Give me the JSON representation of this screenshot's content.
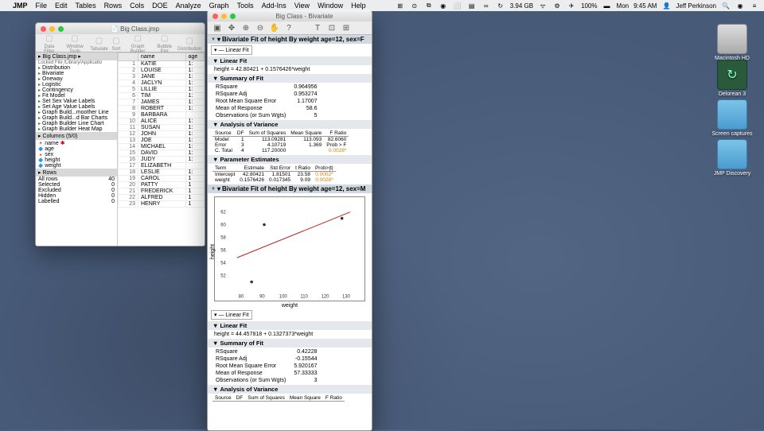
{
  "menubar": {
    "apple": "",
    "app": "JMP",
    "items": [
      "File",
      "Edit",
      "Tables",
      "Rows",
      "Cols",
      "DOE",
      "Analyze",
      "Graph",
      "Tools",
      "Add-Ins",
      "View",
      "Window",
      "Help"
    ],
    "right": {
      "icons": [
        "⊞",
        "⊙",
        "⧉",
        "◉",
        "⬜",
        "▤",
        "∞",
        "↻",
        "⚙",
        "✈",
        "ᛒ",
        "⏻",
        "⌨",
        "≡"
      ],
      "mem": "3.94 GB",
      "wifi": "ᯤ",
      "bat": "100%",
      "batico": "▬",
      "day": "Mon",
      "time": "9:45 AM",
      "user": "Jeff Perkinson",
      "spotlight": "🔍",
      "siri": "◉",
      "notif": "≡"
    }
  },
  "win1": {
    "title": "Big Class.jmp",
    "toolbar_labels": [
      "Data Filter",
      "Window Tools",
      "Tabulate",
      "Sort",
      "Graph Builder",
      "Bubble Plot",
      "Distribution"
    ],
    "panel_header": "Big Class.jmp",
    "locked": "Locked File  /Library/Applicatio",
    "scripts": [
      "Distribution",
      "Bivariate",
      "Oneway",
      "Logistic",
      "Contingency",
      "Fit Model",
      "Set Sex Value Labels",
      "Set Age Value Labels",
      "Graph Build...moother Line",
      "Graph Build...d Bar Charts",
      "Graph Builder Line Chart",
      "Graph Builder Heat Map"
    ],
    "cols_header": "Columns (5/0)",
    "cols": [
      "name",
      "age",
      "sex",
      "height",
      "weight"
    ],
    "rows_header": "Rows",
    "rows_stats": [
      [
        "All rows",
        "40"
      ],
      [
        "Selected",
        "0"
      ],
      [
        "Excluded",
        "0"
      ],
      [
        "Hidden",
        "0"
      ],
      [
        "Labelled",
        "0"
      ]
    ],
    "table_headers": [
      "",
      "name",
      "age"
    ],
    "table_rows": [
      [
        "1",
        "KATIE",
        "1:"
      ],
      [
        "2",
        "LOUISE",
        "1:"
      ],
      [
        "3",
        "JANE",
        "1:"
      ],
      [
        "4",
        "JACLYN",
        "1:"
      ],
      [
        "5",
        "LILLIE",
        "1:"
      ],
      [
        "6",
        "TIM",
        "1:"
      ],
      [
        "7",
        "JAMES",
        "1:"
      ],
      [
        "8",
        "ROBERT",
        "1:"
      ],
      [
        "9",
        "BARBARA",
        ""
      ],
      [
        "10",
        "ALICE",
        "1:"
      ],
      [
        "11",
        "SUSAN",
        "1:"
      ],
      [
        "12",
        "JOHN",
        "1:"
      ],
      [
        "13",
        "JOE",
        "1:"
      ],
      [
        "14",
        "MICHAEL",
        "1:"
      ],
      [
        "15",
        "DAVID",
        "1:"
      ],
      [
        "16",
        "JUDY",
        "1:"
      ],
      [
        "17",
        "ELIZABETH",
        ""
      ],
      [
        "18",
        "LESLIE",
        "1:"
      ],
      [
        "19",
        "CAROL",
        "1"
      ],
      [
        "20",
        "PATTY",
        "1"
      ],
      [
        "21",
        "FREDERICK",
        "1"
      ],
      [
        "22",
        "ALFRED",
        "1"
      ],
      [
        "23",
        "HENRY",
        "1"
      ]
    ]
  },
  "win2": {
    "title": "Big Class - Bivariate",
    "toolbar_icons": [
      "▣",
      "✥",
      "⊕",
      "⊖",
      "✋",
      "?",
      "",
      "T",
      "⊡",
      "⊞"
    ],
    "s1": {
      "header": "Bivariate Fit of height By weight age=12, sex=F",
      "linear_fit_label": "Linear Fit",
      "formula": "height = 42.80421 + 0.1576426*weight",
      "summary_hdr": "Summary of Fit",
      "summary": [
        [
          "RSquare",
          "0.964956"
        ],
        [
          "RSquare Adj",
          "0.953274"
        ],
        [
          "Root Mean Square Error",
          "1.17007"
        ],
        [
          "Mean of Response",
          "58.6"
        ],
        [
          "Observations (or Sum Wgts)",
          "5"
        ]
      ],
      "anova_hdr": "Analysis of Variance",
      "anova_cols": [
        "Source",
        "DF",
        "Sum of Squares",
        "Mean Square",
        "F Ratio"
      ],
      "anova_rows": [
        [
          "Model",
          "1",
          "113.09281",
          "113.093",
          "82.6060"
        ],
        [
          "Error",
          "3",
          "4.10719",
          "1.369",
          "Prob > F"
        ],
        [
          "C. Total",
          "4",
          "117.20000",
          "",
          "0.0028*"
        ]
      ],
      "param_hdr": "Parameter Estimates",
      "param_cols": [
        "Term",
        "Estimate",
        "Std Error",
        "t Ratio",
        "Prob>|t|"
      ],
      "param_rows": [
        [
          "Intercept",
          "42.80421",
          "1.81501",
          "23.58",
          "0.0002*"
        ],
        [
          "weight",
          "0.1576426",
          "0.017345",
          "9.09",
          "0.0028*"
        ]
      ]
    },
    "s2": {
      "header": "Bivariate Fit of height By weight age=12, sex=M",
      "y_label": "height",
      "x_label": "weight",
      "linear_fit_label": "Linear Fit",
      "formula": "height = 44.457818 + 0.1327373*weight",
      "summary_hdr": "Summary of Fit",
      "summary": [
        [
          "RSquare",
          "0.42228"
        ],
        [
          "RSquare Adj",
          "-0.15544"
        ],
        [
          "Root Mean Square Error",
          "5.920167"
        ],
        [
          "Mean of Response",
          "57.33333"
        ],
        [
          "Observations (or Sum Wgts)",
          "3"
        ]
      ],
      "anova_hdr": "Analysis of Variance",
      "anova_cols": [
        "Source",
        "DF",
        "Sum of Squares",
        "Mean Square",
        "F Ratio"
      ]
    }
  },
  "chart_data": {
    "type": "scatter",
    "title": "",
    "xlabel": "weight",
    "ylabel": "height",
    "xlim": [
      75,
      135
    ],
    "ylim": [
      50,
      63
    ],
    "x_ticks": [
      80,
      90,
      100,
      110,
      120,
      130
    ],
    "series": [
      {
        "name": "points",
        "type": "scatter",
        "x": [
          85,
          91,
          128
        ],
        "y": [
          51,
          60,
          61
        ]
      },
      {
        "name": "fit",
        "type": "line",
        "x": [
          78,
          132
        ],
        "y": [
          54.8,
          62.0
        ]
      }
    ]
  },
  "desktop": {
    "icons": [
      {
        "name": "Macintosh HD",
        "type": "hd"
      },
      {
        "name": "Delorean 3",
        "type": "tm"
      },
      {
        "name": "Screen captures",
        "type": "folder"
      },
      {
        "name": "JMP Discovery",
        "type": "folder"
      }
    ]
  }
}
